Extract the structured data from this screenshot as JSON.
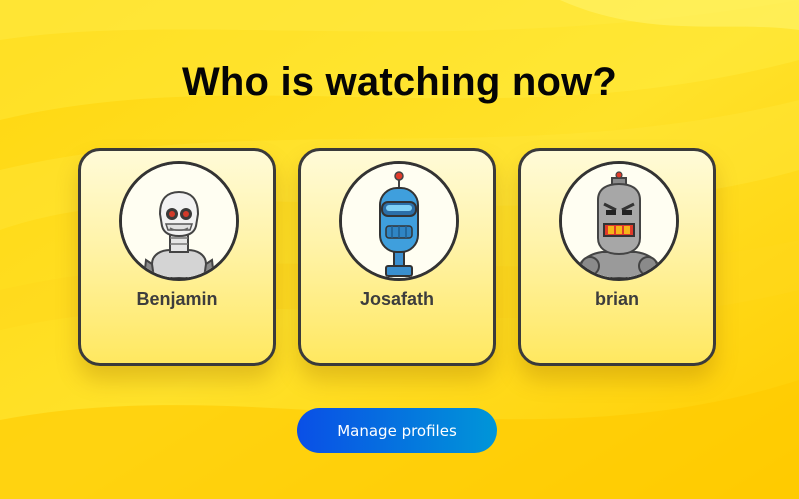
{
  "page": {
    "title": "Who is watching now?"
  },
  "profiles": [
    {
      "name": "Benjamin",
      "avatar_icon": "silver-robot-icon"
    },
    {
      "name": "Josafath",
      "avatar_icon": "blue-robot-icon"
    },
    {
      "name": "brian",
      "avatar_icon": "gray-robot-icon"
    }
  ],
  "actions": {
    "manage_label": "Manage profiles"
  },
  "colors": {
    "background": "#ffd21a",
    "card_border": "#3a3a3a",
    "button_start": "#0a4fe6",
    "button_end": "#0096d8"
  }
}
